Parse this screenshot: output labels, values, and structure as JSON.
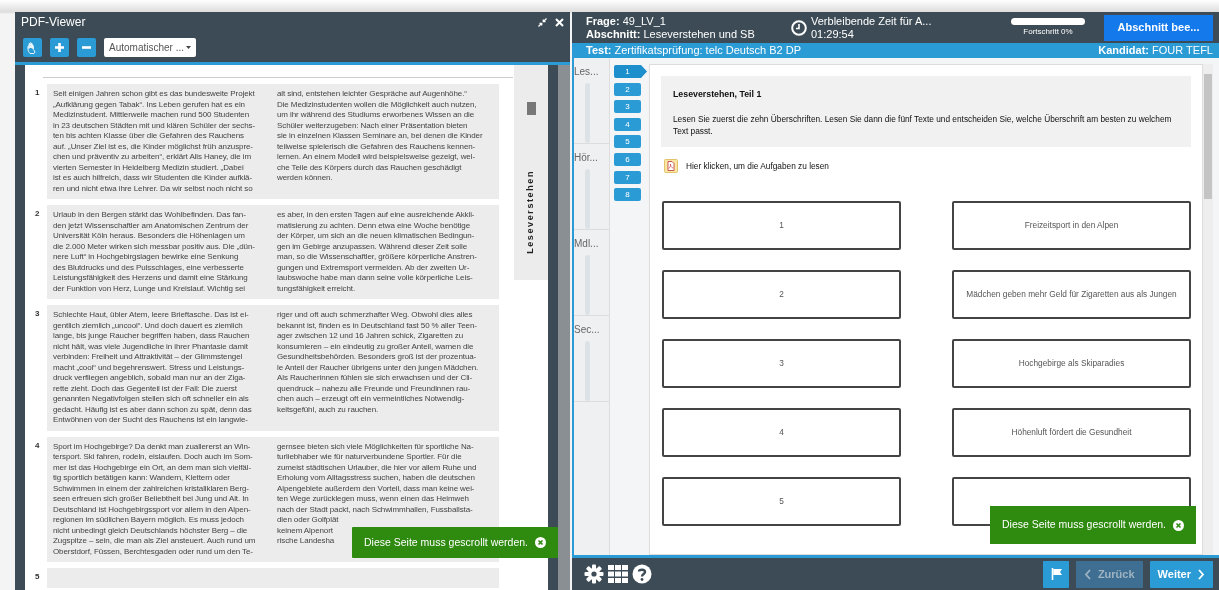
{
  "pdf_viewer": {
    "title": "PDF-Viewer",
    "zoom_select": "Automatischer ...",
    "side_tab": "Leseverstehen",
    "texts": [
      {
        "number": "1",
        "columns": [
          [
            "Seit einigen Jahren schon gibt es das bundesweite Projekt",
            "„Aufklärung gegen Tabak“. Ins Leben gerufen hat es ein",
            "Medizinstudent. Mittlerweile machen rund 500 Studenten",
            "in 23 deutschen Städten mit und klären Schüler der sechs-",
            "ten bis achten Klasse über die Gefahren des Rauchens",
            "auf. „Unser Ziel ist es, die Kinder möglichst früh anzuspre-",
            "chen und präventiv zu arbeiten“, erklärt Alis Haney, die im",
            "vierten Semester in Heidelberg Medizin studiert. „Dabei",
            "ist es auch hilfreich, dass wir Studenten die Kinder aufklä-",
            "ren und nicht etwa ihre Lehrer. Da wir selbst noch nicht so"
          ],
          [
            "alt sind, entstehen leichter Gespräche auf Augenhöhe.“",
            "Die Medizinstudenten wollen die Möglichkeit auch nutzen,",
            "um ihr während des Studiums erworbenes Wissen an die",
            "Schüler weiterzugeben: Nach einer Präsentation bieten",
            "sie in einzelnen Klassen Seminare an, bei denen die Kinder",
            "teilweise spielerisch die Gefahren des Rauchens kennen-",
            "lernen. An einem Modell wird beispielsweise gezeigt, wel-",
            "che Teile des Körpers durch das Rauchen geschädigt",
            "werden können."
          ]
        ]
      },
      {
        "number": "2",
        "columns": [
          [
            "Urlaub in den Bergen stärkt das Wohlbefinden. Das fan-",
            "den jetzt Wissenschaftler am Anatomischen Zentrum der",
            "Universität Köln heraus. Besonders die Höhenlagen um",
            "die 2.000 Meter wirken sich messbar positiv aus. Die „dün-",
            "nere Luft“ in Hochgebirgslagen bewirke eine Senkung",
            "des Blutdrucks und des Pulsschlages, eine verbesserte",
            "Leistungsfähigkeit des Herzens und damit eine Stärkung",
            "der Funktion von Herz, Lunge und Kreislauf. Wichtig sei"
          ],
          [
            "es aber, in den ersten Tagen auf eine ausreichende Akkli-",
            "matisierung zu achten. Denn etwa eine Woche benötige",
            "der Körper, um sich an die neuen klimatischen Bedingun-",
            "gen im Gebirge anzupassen. Während dieser Zeit solle",
            "man, so die Wissenschaftler, größere körperliche Anstren-",
            "gungen und Extremsport vermeiden. Ab der zweiten Ur-",
            "laubswoche habe man dann seine volle körperliche Leis-",
            "tungsfähigkeit erreicht."
          ]
        ]
      },
      {
        "number": "3",
        "columns": [
          [
            "Schlechte Haut, übler Atem, leere Brieftasche. Das ist ei-",
            "gentlich ziemlich „uncool“. Und doch dauert es ziemlich",
            "lange, bis junge Raucher begriffen haben, dass Rauchen",
            "nicht hält, was viele Jugendliche in ihrer Phantasie damit",
            "verbinden: Freiheit und Attraktivität – der Glimmstengel",
            "macht „cool“ und begehrenswert. Stress und Leistungs-",
            "druck verfliegen angeblich, sobald man nur an der Ziga-",
            "rette zieht. Doch das Gegenteil ist der Fall: Die zuerst",
            "genannten Negativfolgen stellen sich oft schneller ein als",
            "gedacht. Häufig ist es aber dann schon zu spät, denn das",
            "Entwöhnen von der Sucht des Rauchens ist ein langwie-"
          ],
          [
            "riger und oft auch schmerzhafter Weg. Obwohl dies alles",
            "bekannt ist, finden es in Deutschland fast 50 % aller Teen-",
            "ager zwischen 12 und 16 Jahren schick, Zigaretten zu",
            "konsumieren – ein eindeutig zu großer Anteil, warnen die",
            "Gesundheitsbehörden. Besonders groß ist der prozentua-",
            "le Anteil der Raucher übrigens unter den jungen Mädchen.",
            "Als Raucherinnen fühlen sie sich erwachsen und der Cli-",
            "quendruck – nahezu alle Freunde und Freundinnen rau-",
            "chen auch – erzeugt oft ein vermeintliches Notwendig-",
            "keitsgefühl, auch zu rauchen."
          ]
        ]
      },
      {
        "number": "4",
        "columns": [
          [
            "Sport im Hochgebirge? Da denkt man zuallererst an Win-",
            "tersport. Ski fahren, rodeln, eislaufen. Doch auch im Som-",
            "mer ist das Hochgebirge ein Ort, an dem man sich vielfäl-",
            "tig sportlich betätigen kann: Wandern, Klettern oder",
            "Schwimmen in einem der zahlreichen kristallklaren Berg-",
            "seen erfreuen sich großer Beliebtheit bei Jung und Alt. In",
            "Deutschland ist Hochgebirgssport vor allem in den Alpen-",
            "regionen im südlichen Bayern möglich. Es muss jedoch",
            "nicht unbedingt gleich Deutschlands höchster Berg – die",
            "Zugspitze – sein, die man als Ziel ansteuert. Auch rund um",
            "Oberstdorf, Füssen, Berchtesgaden oder rund um den Te-"
          ],
          [
            "gernsee bieten sich viele Möglichkeiten für sportliche Na-",
            "turliebhaber wie für naturverbundene Sportler. Für die",
            "zumeist städtischen Urlauber, die hier vor allem Ruhe und",
            "Erholung vom Alltagsstress suchen, haben die deutschen",
            "Alpengebiete außerdem den Vorteil, dass man keine wei-",
            "ten Wege zurücklegen muss, wenn einen das Heimweh",
            "nach der Stadt packt, nach Schwimmhallen, Fussballsta-",
            "dien oder Golfplät",
            "keinem Alpenort",
            "rische Landesha"
          ]
        ]
      },
      {
        "number": "5"
      }
    ],
    "toast": "Diese Seite muss gescrollt werden."
  },
  "exam": {
    "question": "**Frage:** 49_LV_1",
    "section": "**Abschnitt:** Leseverstehen und SB",
    "timer": "Verbleibende Zeit für A...",
    "time": "01:29:54",
    "progress": {
      "level": 0,
      "label": "Fortschritt 0%"
    },
    "end_button": "Abschnitt bee...",
    "test": "**Test:** Zertifikatsprüfung: telc Deutsch B2 DP",
    "candidate": "**Kandidat:** FOUR TEFL"
  },
  "sections": [
    {
      "label": "Les..."
    },
    {
      "label": "Hör..."
    },
    {
      "label": "Mdl..."
    },
    {
      "label": "Sec..."
    }
  ],
  "questions": [
    {
      "label": "1",
      "selected": true
    },
    {
      "label": "2",
      "selected": false
    },
    {
      "label": "3",
      "selected": false
    },
    {
      "label": "4",
      "selected": false
    },
    {
      "label": "5",
      "selected": false
    },
    {
      "label": "6",
      "selected": false
    },
    {
      "label": "7",
      "selected": false
    },
    {
      "label": "8",
      "selected": false
    }
  ],
  "task": {
    "title": "Leseverstehen, Teil 1",
    "instructions": "Lesen Sie zuerst die zehn Überschriften. Lesen Sie dann die fünf Texte und entscheiden Sie, welche Überschrift am besten zu welchem Text passt.",
    "pdf_link": "Hier klicken, um die Aufgaben zu lesen"
  },
  "text_slots": [
    "1",
    "2",
    "3",
    "4",
    "5"
  ],
  "headings": [
    {
      "text": "Freizeitsport in den Alpen"
    },
    {
      "text": "Mädchen geben mehr Geld für Zigaretten aus als Jungen"
    },
    {
      "text": "Hochgebirge als Skiparadies"
    },
    {
      "text": "Höhenluft fördert die Gesundheit"
    }
  ],
  "toast": "Diese Seite muss gescrollt werden.",
  "footer": {
    "back": {
      "label": "Zurück",
      "disabled": true
    },
    "next": {
      "label": "Weiter",
      "disabled": false
    }
  }
}
